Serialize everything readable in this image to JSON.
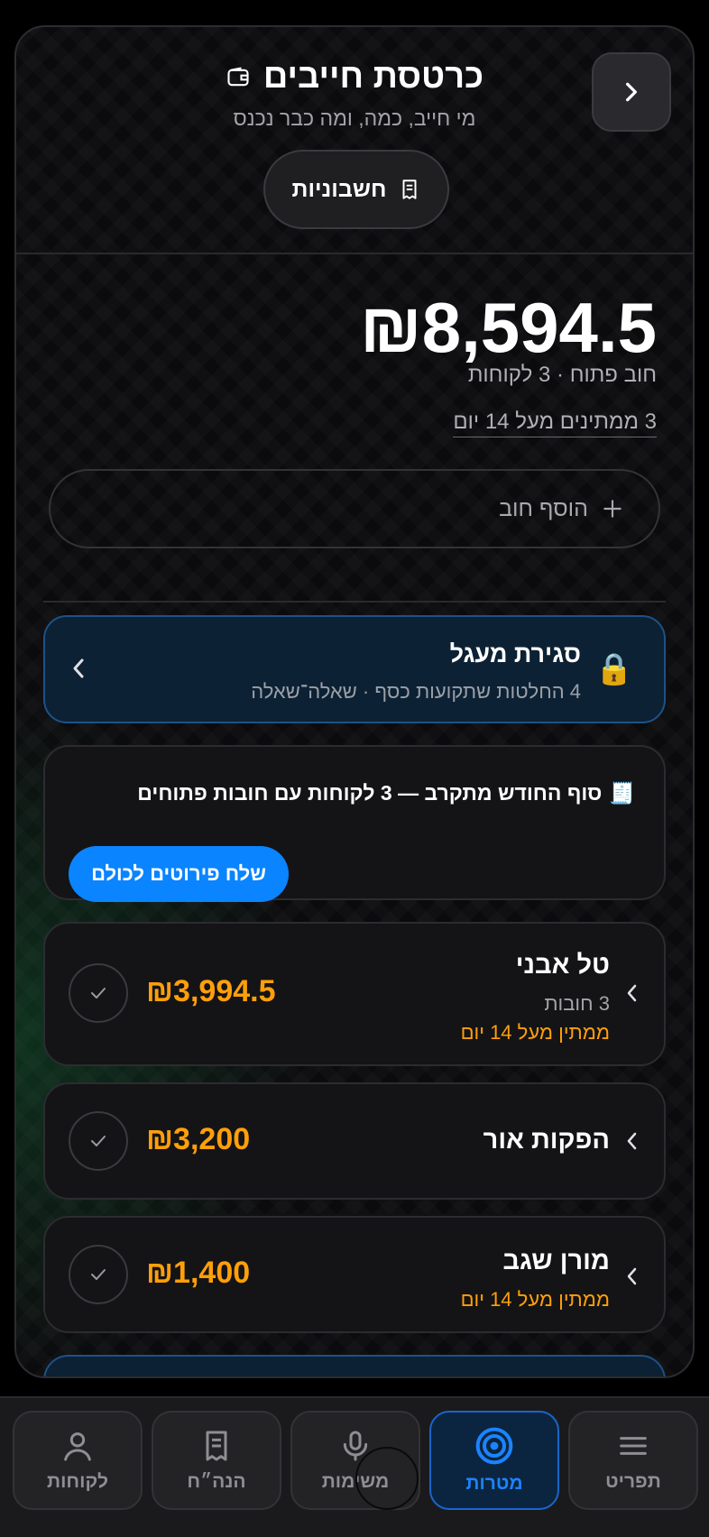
{
  "header": {
    "title": "כרטסת חייבים",
    "subtitle": "מי חייב, כמה, ומה כבר נכנס",
    "invoices_label": "חשבוניות"
  },
  "summary": {
    "total": "₪8,594.5",
    "total_sub": "חוב פתוח · 3 לקוחות",
    "waiting_link": "3 ממתינים מעל 14 יום",
    "add_debt_label": "הוסף חוב"
  },
  "circle": {
    "title": "סגירת מעגל",
    "subtitle": "4 החלטות שתקועות כסף · שאלה־שאלה"
  },
  "reminder": {
    "text": "סוף החודש מתקרב — 3 לקוחות עם חובות פתוחים",
    "icon": "🧾",
    "button": "שלח פירוטים לכולם"
  },
  "debtors": [
    {
      "name": "טל אבני",
      "count": "3 חובות",
      "waiting": "ממתין מעל 14 יום",
      "amount": "₪3,994.5"
    },
    {
      "name": "הפקות אור",
      "amount": "₪3,200"
    },
    {
      "name": "מורן שגב",
      "waiting": "ממתין מעל 14 יום",
      "amount": "₪1,400"
    }
  ],
  "tabs": [
    {
      "label": "תפריט",
      "icon": "menu-icon"
    },
    {
      "label": "מטרות",
      "icon": "target-icon",
      "active": true
    },
    {
      "label": "משימות",
      "icon": "microphone-icon"
    },
    {
      "label": "הנה״ח",
      "icon": "receipt-icon"
    },
    {
      "label": "לקוחות",
      "icon": "person-icon"
    }
  ],
  "colors": {
    "accent": "#0a84ff",
    "warning": "#ff9f0a",
    "background": "#0b0b0d"
  }
}
